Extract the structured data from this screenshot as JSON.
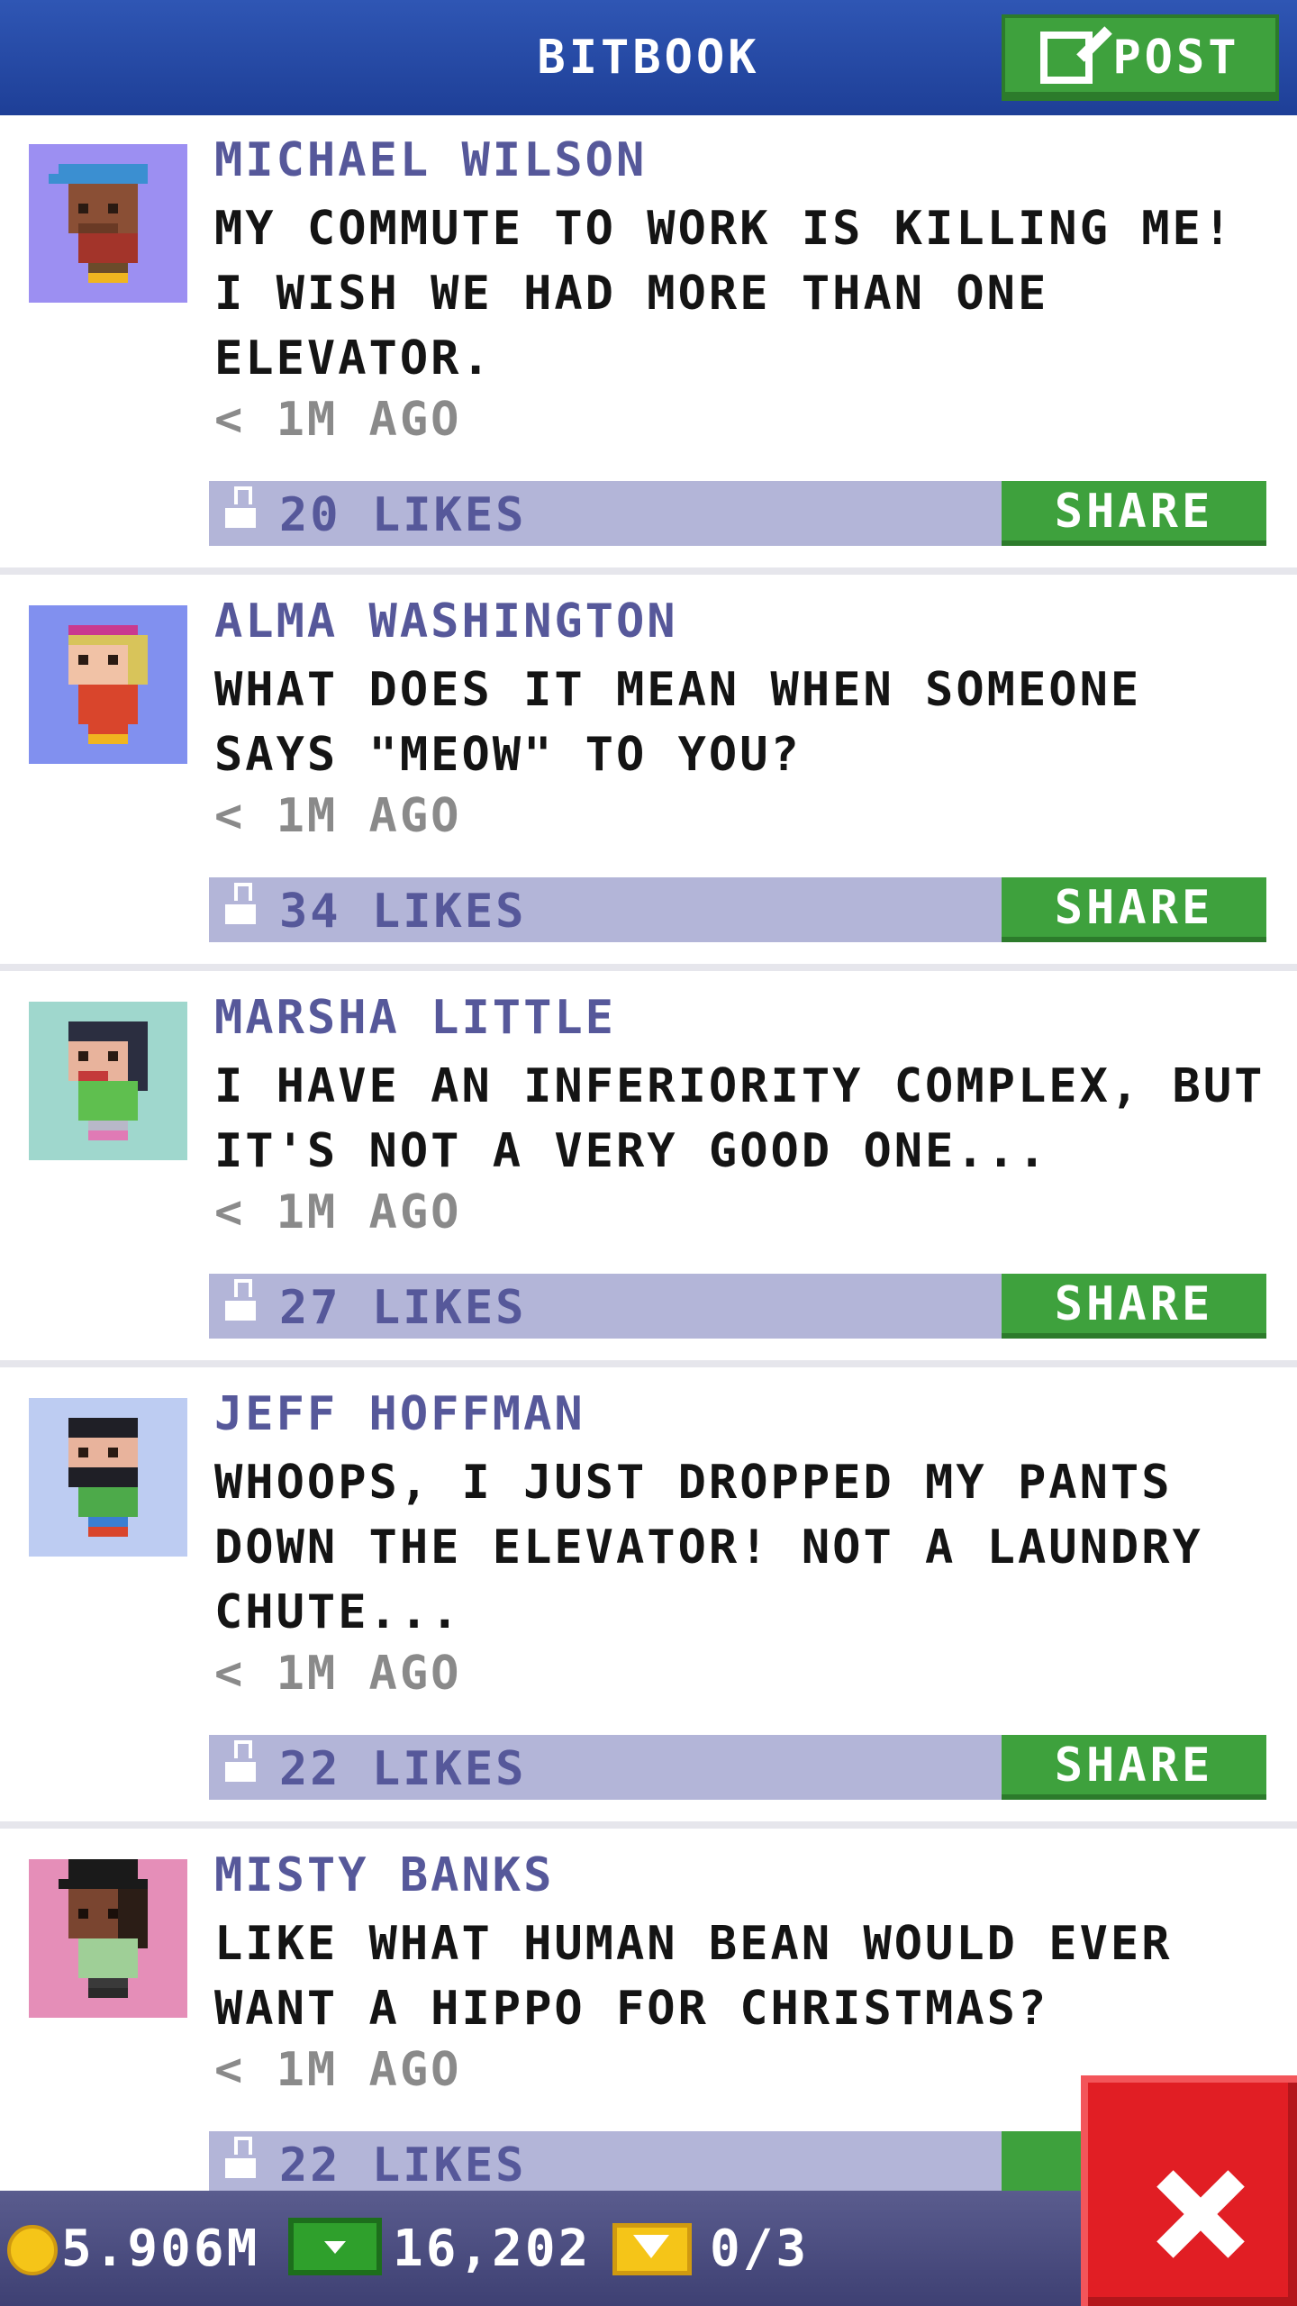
{
  "header": {
    "title": "BITBOOK",
    "post_label": "POST"
  },
  "feed": {
    "posts": [
      {
        "author": "MICHAEL WILSON",
        "message": "MY COMMUTE TO WORK IS KILLING ME! I WISH WE HAD MORE THAN ONE ELEVATOR.",
        "time": "< 1M AGO",
        "likes": "20 LIKES",
        "share_label": "SHARE",
        "avatar_bg": "#9c8ff2"
      },
      {
        "author": "ALMA WASHINGTON",
        "message": "WHAT DOES IT MEAN WHEN SOMEONE SAYS \"MEOW\" TO YOU?",
        "time": "< 1M AGO",
        "likes": "34 LIKES",
        "share_label": "SHARE",
        "avatar_bg": "#8190ef"
      },
      {
        "author": "MARSHA LITTLE",
        "message": "I HAVE AN INFERIORITY COMPLEX, BUT IT'S NOT A VERY GOOD ONE...",
        "time": "< 1M AGO",
        "likes": "27 LIKES",
        "share_label": "SHARE",
        "avatar_bg": "#9fd7cd"
      },
      {
        "author": "JEFF HOFFMAN",
        "message": "WHOOPS, I JUST DROPPED MY PANTS DOWN THE ELEVATOR! NOT A LAUNDRY CHUTE...",
        "time": "< 1M AGO",
        "likes": "22 LIKES",
        "share_label": "SHARE",
        "avatar_bg": "#bdccf2"
      },
      {
        "author": "MISTY BANKS",
        "message": "LIKE WHAT HUMAN BEAN WOULD EVER WANT A HIPPO FOR CHRISTMAS?",
        "time": "< 1M AGO",
        "likes": "22 LIKES",
        "share_label": "S",
        "avatar_bg": "#e58eb8"
      }
    ]
  },
  "footer": {
    "coins": "5.906M",
    "bux": "16,202",
    "tickets": "0/3"
  },
  "icons": {
    "post": "edit-icon",
    "like": "thumb-up-icon",
    "coin": "coin-icon",
    "bux": "cash-icon",
    "ticket": "ticket-icon",
    "close": "close-icon"
  },
  "colors": {
    "header": "#2f56b4",
    "accent_green": "#3ea13d",
    "likes_bar": "#b3b5d8",
    "author_text": "#56589a",
    "close_red": "#e11e24"
  }
}
